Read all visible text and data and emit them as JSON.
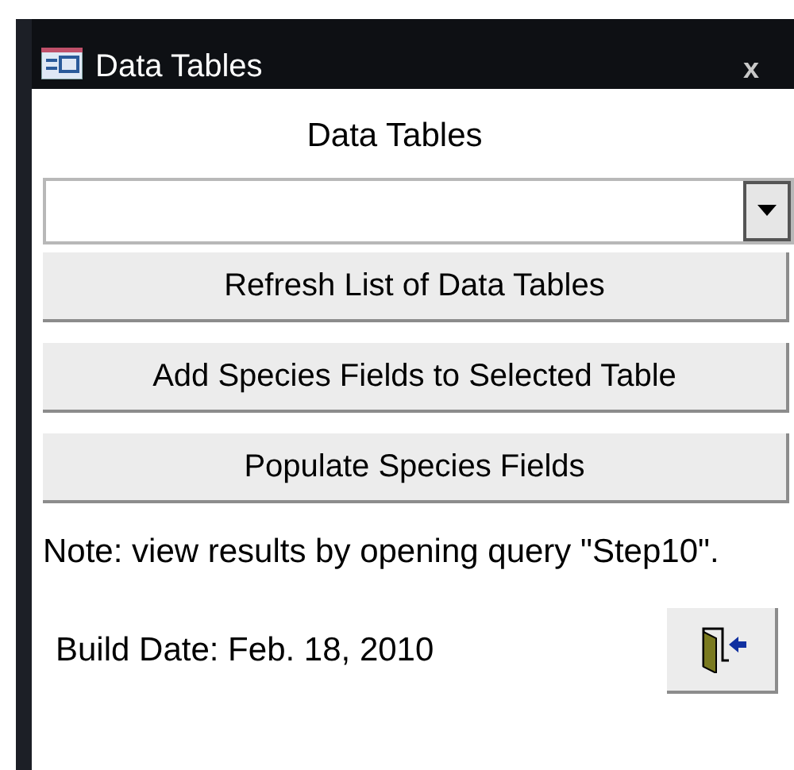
{
  "window": {
    "title": "Data Tables",
    "close": "x"
  },
  "heading": "Data Tables",
  "buttons": [
    "Refresh List of Data Tables",
    "Add Species Fields to Selected Table",
    "Populate Species Fields"
  ],
  "note": "Note: view results by opening query \"Step10\".",
  "build_date": "Build Date: Feb. 18, 2010"
}
